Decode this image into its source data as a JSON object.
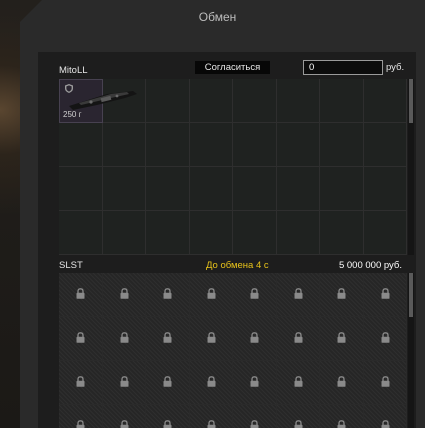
{
  "window": {
    "title": "Обмен"
  },
  "my_side": {
    "name": "MitoLL",
    "agree_label": "Согласиться",
    "money_value": "0",
    "currency": "руб.",
    "grid": {
      "rows": 4,
      "cols": 8
    },
    "items": [
      {
        "slot": 0,
        "weight_label": "250 г",
        "icon": "weapon-part-icon",
        "badge_icon": "shield-icon"
      }
    ]
  },
  "other_side": {
    "name": "SLST",
    "timer_text": "До обмена 4 с",
    "offer_amount": "5 000 000 руб.",
    "grid": {
      "rows": 4,
      "cols": 8
    },
    "slot_icon": "lock-icon"
  },
  "colors": {
    "timer": "#e8c31a",
    "item_bg": "#2a2530"
  }
}
